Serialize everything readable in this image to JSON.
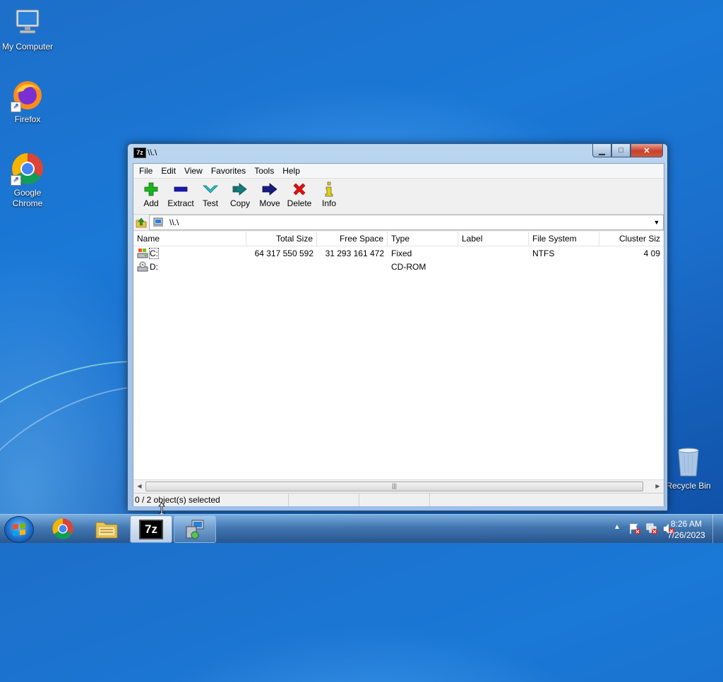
{
  "desktop": {
    "icons": [
      {
        "label": "My Computer"
      },
      {
        "label": "Firefox"
      },
      {
        "label": "Google Chrome"
      },
      {
        "label": "Recycle Bin"
      }
    ]
  },
  "window": {
    "title": "\\\\.\\",
    "app_icon_text": "7z",
    "menu": [
      "File",
      "Edit",
      "View",
      "Favorites",
      "Tools",
      "Help"
    ],
    "toolbar": [
      {
        "label": "Add",
        "icon": "plus-icon",
        "color": "#1bb31b"
      },
      {
        "label": "Extract",
        "icon": "minus-icon",
        "color": "#1a1ab0"
      },
      {
        "label": "Test",
        "icon": "check-icon",
        "color": "#24b6b6"
      },
      {
        "label": "Copy",
        "icon": "double-arrow-right-icon",
        "color": "#157a7a"
      },
      {
        "label": "Move",
        "icon": "arrow-right-icon",
        "color": "#1a1a80"
      },
      {
        "label": "Delete",
        "icon": "x-icon",
        "color": "#e01010"
      },
      {
        "label": "Info",
        "icon": "info-icon",
        "color": "#d8c800"
      }
    ],
    "address": {
      "value": "\\\\.\\"
    },
    "columns": [
      "Name",
      "Total Size",
      "Free Space",
      "Type",
      "Label",
      "File System",
      "Cluster Siz"
    ],
    "rows": [
      {
        "name": "C:",
        "total_size": "64 317 550 592",
        "free_space": "31 293 161 472",
        "type": "Fixed",
        "label": "",
        "file_system": "NTFS",
        "cluster_size": "4 09"
      },
      {
        "name": "D:",
        "total_size": "",
        "free_space": "",
        "type": "CD-ROM",
        "label": "",
        "file_system": "",
        "cluster_size": ""
      }
    ],
    "status": {
      "selection": "0 / 2 object(s) selected"
    }
  },
  "taskbar": {
    "apps": [
      "Start",
      "Google Chrome",
      "Windows Explorer",
      "7-Zip File Manager",
      "Network and Sharing"
    ],
    "clock": {
      "time": "8:26 AM",
      "date": "7/26/2023"
    }
  }
}
